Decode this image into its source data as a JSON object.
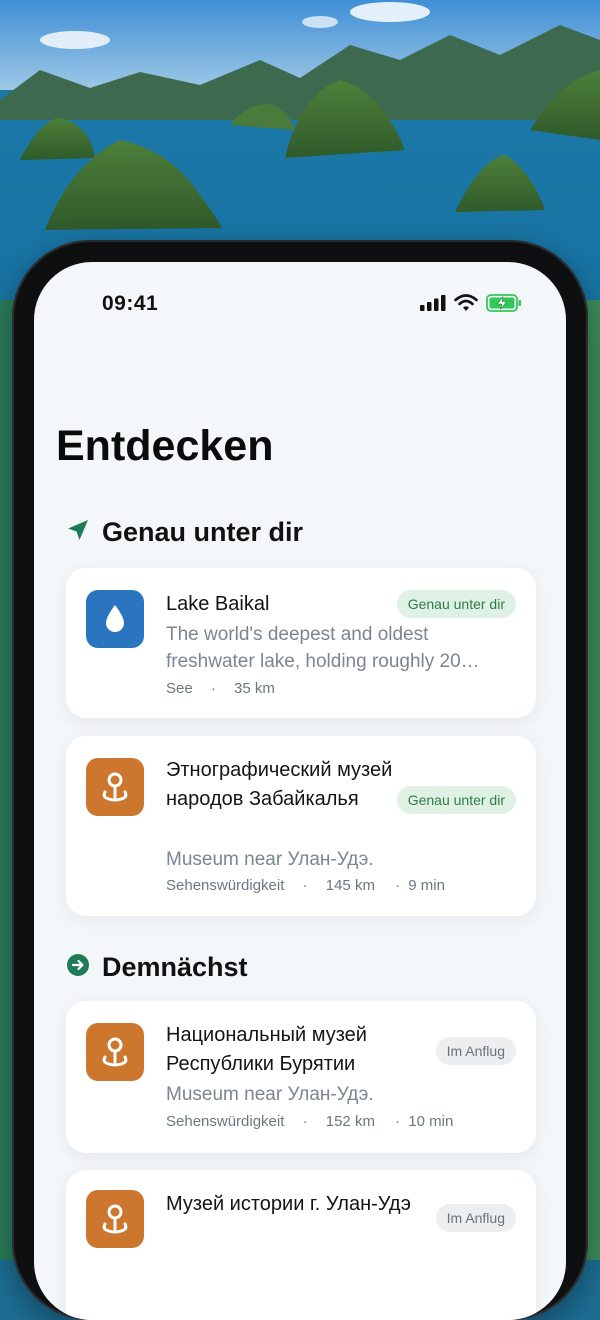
{
  "status_bar": {
    "time": "09:41"
  },
  "page": {
    "title": "Entdecken"
  },
  "sections": [
    {
      "title": "Genau unter dir",
      "icon": "location-arrow-icon",
      "cards": [
        {
          "title": "Lake Baikal",
          "icon": "water-drop-icon",
          "badge": "Genau unter dir",
          "description": "The world's deepest and oldest freshwater lake, holding roughly 20…",
          "category": "See",
          "distance": "35 km",
          "time": ""
        },
        {
          "title": "Этнографический музей народов Забайкалья",
          "icon": "map-pin-icon",
          "badge": "Genau unter dir",
          "description": "Museum near Улан-Удэ.",
          "category": "Sehenswürdigkeit",
          "distance": "145 km",
          "time": "9 min"
        }
      ]
    },
    {
      "title": "Demnächst",
      "icon": "arrow-right-circle-icon",
      "cards": [
        {
          "title": "Национальный музей Республики Бурятии",
          "icon": "map-pin-icon",
          "badge": "Im Anflug",
          "description": "Museum near Улан-Удэ.",
          "category": "Sehenswürdigkeit",
          "distance": "152 km",
          "time": "10 min"
        },
        {
          "title": "Музей истории г. Улан-Удэ",
          "icon": "map-pin-icon",
          "badge": "Im Anflug",
          "description": "",
          "category": "",
          "distance": "",
          "time": ""
        }
      ]
    }
  ],
  "colors": {
    "accent_green": "#1f7a5a",
    "badge_green_bg": "#dff1e4",
    "badge_green_text": "#2e7d46",
    "icon_blue": "#2b74c0",
    "icon_orange": "#cd762d"
  },
  "meta_separator": "·"
}
